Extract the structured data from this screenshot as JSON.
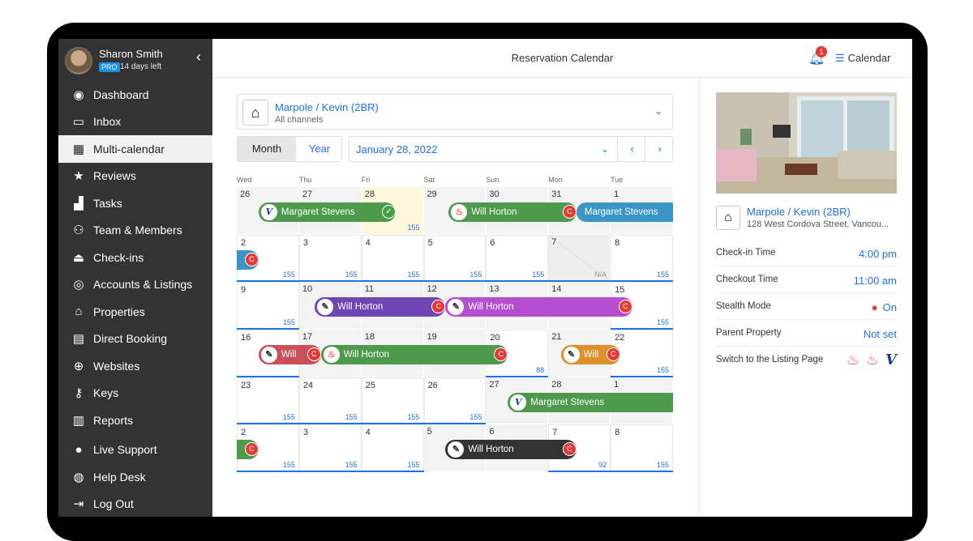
{
  "user": {
    "name": "Sharon Smith",
    "plan": "PRO",
    "trial": "14 days left"
  },
  "sidebar": {
    "items": [
      {
        "label": "Dashboard",
        "icon": "dashboard-icon"
      },
      {
        "label": "Inbox",
        "icon": "inbox-icon"
      },
      {
        "label": "Multi-calendar",
        "icon": "calendar-grid-icon",
        "active": true
      },
      {
        "label": "Reviews",
        "icon": "star-icon"
      },
      {
        "label": "Tasks",
        "icon": "tasks-icon"
      },
      {
        "label": "Team & Members",
        "icon": "team-icon"
      },
      {
        "label": "Check-ins",
        "icon": "bell-service-icon"
      },
      {
        "label": "Accounts & Listings",
        "icon": "account-icon"
      },
      {
        "label": "Properties",
        "icon": "home-icon"
      },
      {
        "label": "Direct Booking",
        "icon": "booking-icon"
      },
      {
        "label": "Websites",
        "icon": "globe-icon"
      },
      {
        "label": "Keys",
        "icon": "key-icon"
      },
      {
        "label": "Reports",
        "icon": "reports-icon"
      },
      {
        "label": "Live Support",
        "icon": "chat-icon"
      },
      {
        "label": "Help Desk",
        "icon": "lifebuoy-icon"
      },
      {
        "label": "Log Out",
        "icon": "logout-icon"
      }
    ]
  },
  "header": {
    "title": "Reservation Calendar",
    "notifications": "1",
    "calendar_link": "Calendar"
  },
  "property_select": {
    "name": "Marpole / Kevin (2BR)",
    "sub": "All channels"
  },
  "view_tabs": {
    "month": "Month",
    "year": "Year"
  },
  "date_select": {
    "value": "January 28, 2022"
  },
  "calendar": {
    "weekdays": [
      "Wed",
      "Thu",
      "Fri",
      "Sat",
      "Sun",
      "Mon",
      "Tue"
    ],
    "weeks": [
      [
        {
          "d": "26",
          "p": ""
        },
        {
          "d": "27",
          "p": ""
        },
        {
          "d": "28",
          "p": "155"
        },
        {
          "d": "29",
          "p": ""
        },
        {
          "d": "30",
          "p": ""
        },
        {
          "d": "31",
          "p": ""
        },
        {
          "d": "1",
          "p": ""
        }
      ],
      [
        {
          "d": "2",
          "p": "155"
        },
        {
          "d": "3",
          "p": "155"
        },
        {
          "d": "4",
          "p": "155"
        },
        {
          "d": "5",
          "p": "155"
        },
        {
          "d": "6",
          "p": "155"
        },
        {
          "d": "7",
          "p": "N/A"
        },
        {
          "d": "8",
          "p": "155"
        }
      ],
      [
        {
          "d": "9",
          "p": "155"
        },
        {
          "d": "10",
          "p": ""
        },
        {
          "d": "11",
          "p": ""
        },
        {
          "d": "12",
          "p": ""
        },
        {
          "d": "13",
          "p": ""
        },
        {
          "d": "14",
          "p": ""
        },
        {
          "d": "15",
          "p": "155"
        }
      ],
      [
        {
          "d": "16",
          "p": ""
        },
        {
          "d": "17",
          "p": ""
        },
        {
          "d": "18",
          "p": ""
        },
        {
          "d": "19",
          "p": ""
        },
        {
          "d": "20",
          "p": "88"
        },
        {
          "d": "21",
          "p": ""
        },
        {
          "d": "22",
          "p": "155"
        }
      ],
      [
        {
          "d": "23",
          "p": "155"
        },
        {
          "d": "24",
          "p": "155"
        },
        {
          "d": "25",
          "p": "155"
        },
        {
          "d": "26",
          "p": "155"
        },
        {
          "d": "27",
          "p": ""
        },
        {
          "d": "28",
          "p": ""
        },
        {
          "d": "1",
          "p": ""
        }
      ],
      [
        {
          "d": "2",
          "p": "155"
        },
        {
          "d": "3",
          "p": "155"
        },
        {
          "d": "4",
          "p": "155"
        },
        {
          "d": "5",
          "p": ""
        },
        {
          "d": "6",
          "p": ""
        },
        {
          "d": "7",
          "p": "92"
        },
        {
          "d": "8",
          "p": "155"
        }
      ]
    ],
    "reservations": [
      {
        "guest": "Margaret Stevens",
        "channel": "vrbo",
        "color": "#4d9a4d",
        "status": "confirmed"
      },
      {
        "guest": "Will Horton",
        "channel": "airbnb",
        "color": "#4d9a4d",
        "status": "cancel"
      },
      {
        "guest": "Margaret Stevens",
        "channel": "",
        "color": "#3b95c7",
        "status": ""
      },
      {
        "guest": "",
        "channel": "",
        "color": "#3b95c7",
        "status": "cancel"
      },
      {
        "guest": "Will Horton",
        "channel": "manual",
        "color": "#6f46b3",
        "status": "cancel"
      },
      {
        "guest": "Will Horton",
        "channel": "manual",
        "color": "#b54fd0",
        "status": "cancel"
      },
      {
        "guest": "Will",
        "channel": "manual",
        "color": "#c9505a",
        "status": "cancel"
      },
      {
        "guest": "Will Horton",
        "channel": "airbnb",
        "color": "#4d9a4d",
        "status": "cancel"
      },
      {
        "guest": "Will",
        "channel": "manual",
        "color": "#e0902a",
        "status": "cancel"
      },
      {
        "guest": "Margaret Stevens",
        "channel": "vrbo",
        "color": "#4d9a4d",
        "status": ""
      },
      {
        "guest": "",
        "channel": "",
        "color": "#4d9a4d",
        "status": "cancel"
      },
      {
        "guest": "Will Horton",
        "channel": "manual",
        "color": "#333333",
        "status": "cancel"
      }
    ]
  },
  "details": {
    "name": "Marpole / Kevin (2BR)",
    "address": "128 West Cordova Street, Vancou...",
    "rows": [
      {
        "label": "Check-in Time",
        "value": "4:00 pm"
      },
      {
        "label": "Checkout Time",
        "value": "11:00 am"
      },
      {
        "label": "Stealth Mode",
        "value": "On"
      },
      {
        "label": "Parent Property",
        "value": "Not set"
      },
      {
        "label": "Switch to the Listing Page",
        "value": ""
      }
    ]
  }
}
